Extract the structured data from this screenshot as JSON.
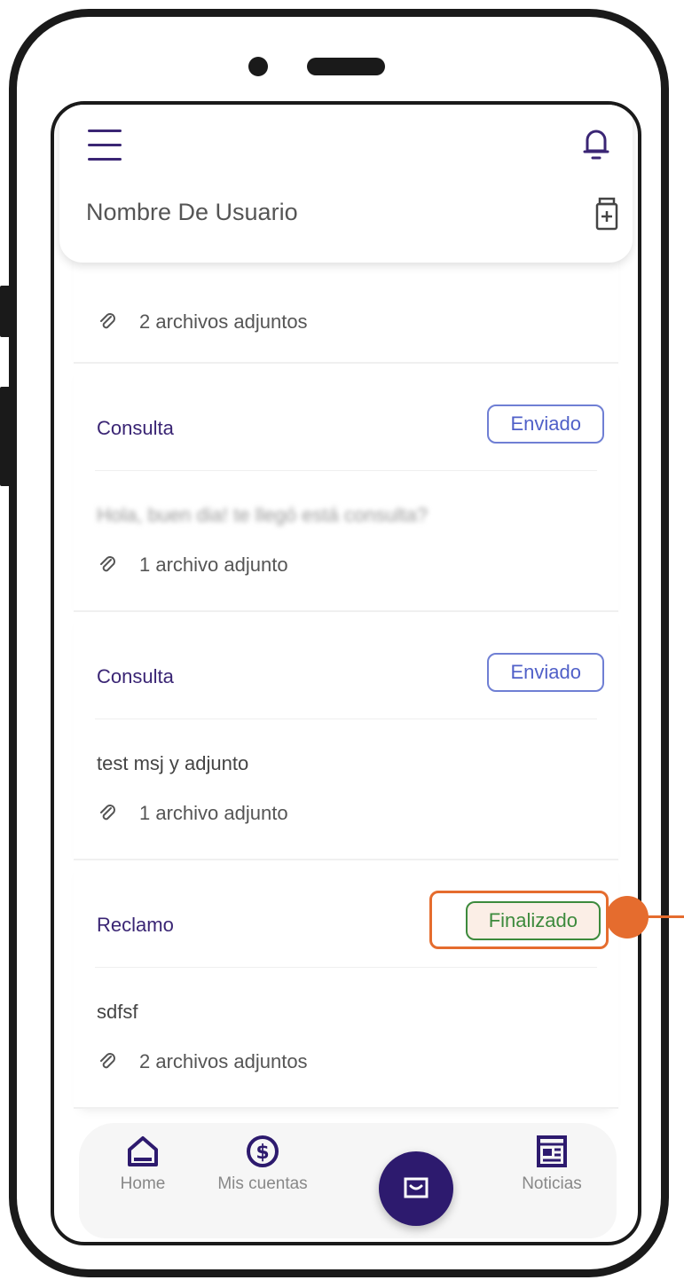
{
  "header": {
    "username": "Nombre De Usuario"
  },
  "messages": [
    {
      "attachments": "2 archivos adjuntos"
    },
    {
      "type": "Consulta",
      "status": "Enviado",
      "text": "Hola, buen dia! te llegó está consulta?",
      "attachments": "1 archivo adjunto"
    },
    {
      "type": "Consulta",
      "status": "Enviado",
      "text": "test msj y adjunto",
      "attachments": "1 archivo adjunto"
    },
    {
      "type": "Reclamo",
      "status": "Finalizado",
      "text": "sdfsf",
      "attachments": "2 archivos adjuntos"
    }
  ],
  "nav": {
    "home_label": "Home",
    "accounts_label": "Mis cuentas",
    "news_label": "Noticias"
  },
  "colors": {
    "primary": "#3a2574",
    "status_sent": "#5060c8",
    "status_finished": "#3c8a3c",
    "callout": "#e56c2e"
  },
  "icons": [
    "menu-icon",
    "bell-icon",
    "medical-kit-icon",
    "paperclip-icon",
    "home-icon",
    "dollar-circle-icon",
    "chat-icon",
    "news-icon"
  ]
}
